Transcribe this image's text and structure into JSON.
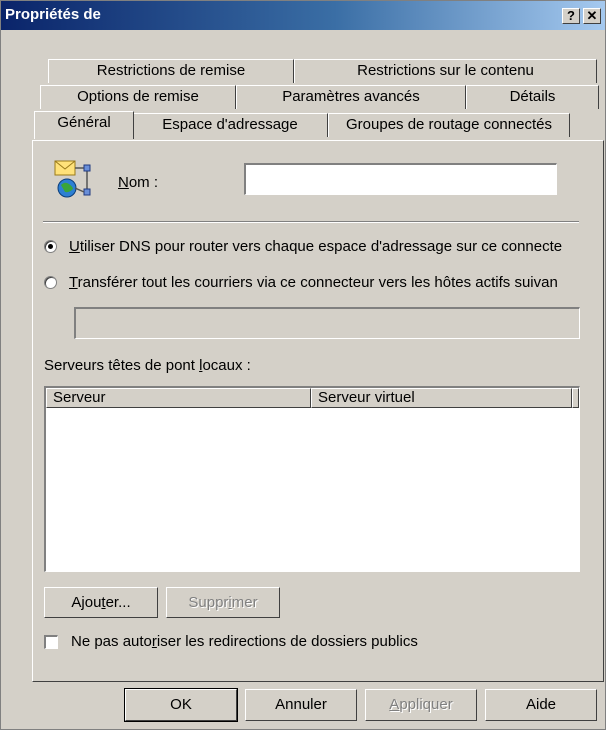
{
  "window": {
    "title": "Propriétés de",
    "help_button": "?",
    "close_button": "✕"
  },
  "tabs": {
    "row1": [
      "Restrictions de remise",
      "Restrictions sur le contenu"
    ],
    "row2": [
      "Options de remise",
      "Paramètres avancés",
      "Détails"
    ],
    "row3": [
      "Général",
      "Espace d'adressage",
      "Groupes de routage connectés"
    ],
    "active": "Général"
  },
  "general": {
    "icon": "connector-mail-globe-icon",
    "name_label_mnemonic": "N",
    "name_label_rest": "om :",
    "name_value": "",
    "radio_dns_mnemonic": "U",
    "radio_dns_rest": "tiliser DNS pour router vers chaque espace d'adressage sur ce connecte",
    "radio_dns_selected": true,
    "radio_forward_mnemonic": "T",
    "radio_forward_rest": "ransférer tout les courriers via ce connecteur vers les hôtes actifs suivan",
    "radio_forward_selected": false,
    "forward_hosts_value": "",
    "bridgehead_label_pre": "Serveurs têtes de pont ",
    "bridgehead_label_mnemonic": "l",
    "bridgehead_label_post": "ocaux :",
    "columns": [
      "Serveur",
      "Serveur virtuel"
    ],
    "rows": [],
    "add_pre": "Ajou",
    "add_mnemonic": "t",
    "add_post": "er...",
    "remove_pre": "Suppr",
    "remove_mnemonic": "i",
    "remove_post": "mer",
    "checkbox_pre": "Ne pas auto",
    "checkbox_mnemonic": "r",
    "checkbox_post": "iser les redirections de dossiers publics",
    "checkbox_checked": false
  },
  "footer": {
    "ok": "OK",
    "cancel": "Annuler",
    "apply_mnemonic": "A",
    "apply_rest": "ppliquer",
    "help": "Aide"
  }
}
